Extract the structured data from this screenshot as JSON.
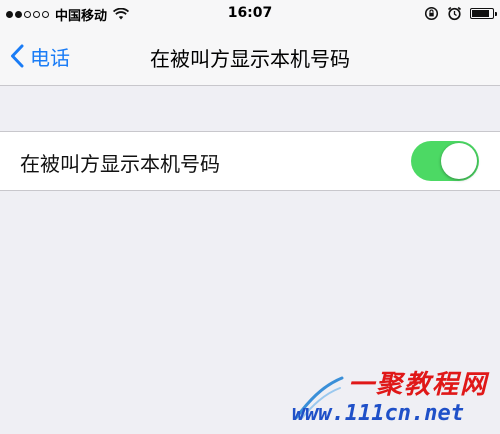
{
  "status_bar": {
    "carrier": "中国移动",
    "time": "16:07",
    "signal_filled": 2,
    "signal_total": 5,
    "battery_level": 0.85
  },
  "nav": {
    "back_label": "电话",
    "title": "在被叫方显示本机号码"
  },
  "settings": {
    "row_label": "在被叫方显示本机号码",
    "toggle_on": true
  },
  "watermark": {
    "top_text": "一聚教程网",
    "bottom_text": "www.111cn.net"
  },
  "colors": {
    "accent": "#1a7cf6",
    "toggle_on": "#4cd964",
    "background": "#efeff4"
  }
}
